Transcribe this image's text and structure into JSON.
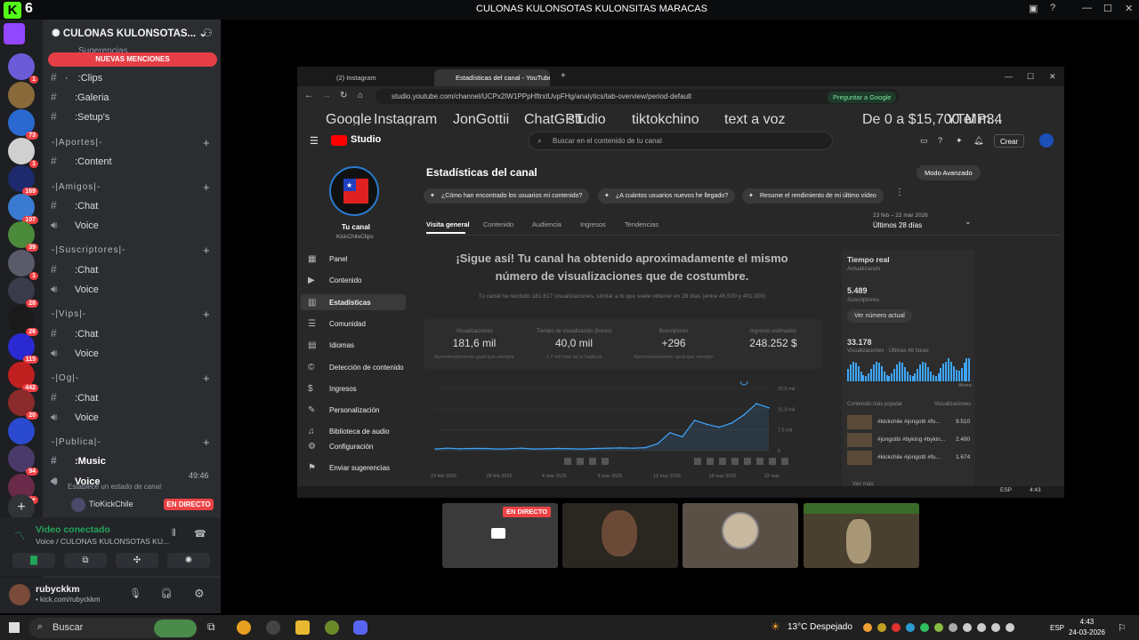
{
  "kick": {
    "logo": "K",
    "count": "6"
  },
  "window": {
    "title": "CULONAS KULONSOTAS KULONSITAS MARACAS"
  },
  "servers": [
    {
      "badge": "1",
      "color": "#6b5bd6"
    },
    {
      "badge": "",
      "color": "#8a6a3a"
    },
    {
      "badge": "73",
      "color": "#2a6ad0"
    },
    {
      "badge": "1",
      "color": "#d0d0d0"
    },
    {
      "badge": "169",
      "color": "#1e2a6e"
    },
    {
      "badge": "107",
      "color": "#3a7ad0"
    },
    {
      "badge": "39",
      "color": "#4a8a3a"
    },
    {
      "badge": "1",
      "color": "#5a5a6a"
    },
    {
      "badge": "28",
      "color": "#3a3a4a"
    },
    {
      "badge": "26",
      "color": "#1a1a1a"
    },
    {
      "badge": "115",
      "color": "#2a2ad0"
    },
    {
      "badge": "442",
      "color": "#c02020"
    },
    {
      "badge": "20",
      "color": "#8a2a2a"
    },
    {
      "badge": "",
      "color": "#2a4ad0"
    },
    {
      "badge": "94",
      "color": "#4a3a6a"
    },
    {
      "badge": "2K+",
      "color": "#6a2a4a"
    }
  ],
  "sidebar": {
    "server_name": "CULONAS KULONSOTAS...",
    "mentions": "NUEVAS MENCIONES",
    "partial_top": "Sugerencias",
    "items": [
      {
        "kind": "ch",
        "label": "· :Clips"
      },
      {
        "kind": "ch",
        "label": " :Galeria"
      },
      {
        "kind": "ch",
        "label": " :Setup's"
      },
      {
        "kind": "cat",
        "label": "-|Aportes|-"
      },
      {
        "kind": "ch",
        "label": " :Content"
      },
      {
        "kind": "cat",
        "label": "-|Amigos|-"
      },
      {
        "kind": "ch",
        "label": " :Chat"
      },
      {
        "kind": "vc",
        "label": " Voice"
      },
      {
        "kind": "cat",
        "label": "-|Suscriptores|-"
      },
      {
        "kind": "ch",
        "label": " :Chat"
      },
      {
        "kind": "vc",
        "label": " Voice"
      },
      {
        "kind": "cat",
        "label": "-|Vips|-"
      },
      {
        "kind": "ch",
        "label": " :Chat"
      },
      {
        "kind": "vc",
        "label": " Voice"
      },
      {
        "kind": "cat",
        "label": "-|Og|-"
      },
      {
        "kind": "ch",
        "label": " :Chat"
      },
      {
        "kind": "vc",
        "label": " Voice"
      },
      {
        "kind": "cat",
        "label": "-|Publica|-"
      },
      {
        "kind": "ch",
        "label": " :Music"
      },
      {
        "kind": "vc",
        "label": " Voice"
      }
    ],
    "voice_timer": "49:46",
    "status_hint": "Establece un estado de canal",
    "member": "TioKickChile",
    "live": "EN DIRECTO"
  },
  "voice": {
    "connected": "Video conectado",
    "channel": "Voice / CULONAS KULONSOTAS KU..."
  },
  "user": {
    "name": "rubyckkm",
    "status": "• kick.com/rubyckkm"
  },
  "browser": {
    "tab1": "(2) Instagram",
    "tab2": "Estadísticas del canal - YouTube",
    "url": "studio.youtube.com/channel/UCPx2IW1PPpHftrxtUvpFHg/analytics/tab-overview/period-default",
    "ask_google": "Preguntar a Google",
    "bookmarks": [
      "Google",
      "Instagram",
      "JonGottii",
      "ChatGPT",
      "studio",
      "tiktokchino",
      "text a voz",
      "De 0 a $15,700 el m...",
      "YTMP34"
    ]
  },
  "studio": {
    "logo": "Studio",
    "search": "Buscar en el contenido de tu canal",
    "create": "Crear",
    "channel_name": "Tu canal",
    "channel_handle": "KickChileClips",
    "nav": [
      "Panel",
      "Contenido",
      "Estadísticas",
      "Comunidad",
      "Idiomas",
      "Detección de contenido",
      "Ingresos",
      "Personalización",
      "Biblioteca de audio",
      "Configuración",
      "Enviar sugerencias"
    ],
    "title": "Estadísticas del canal",
    "advanced": "Modo Avanzado",
    "pills": [
      "¿Cómo han encontrado los usuarios mi contenido?",
      "¿A cuántos usuarios nuevos he llegado?",
      "Resume el rendimiento de mi último vídeo"
    ],
    "tabs": [
      "Visita general",
      "Contenido",
      "Audiencia",
      "Ingresos",
      "Tendencias"
    ],
    "date_range": "23 feb – 22 mar 2026",
    "period": "Últimos 28 días",
    "headline": "¡Sigue así! Tu canal ha obtenido aproximadamente el mismo número de visualizaciones que de costumbre.",
    "subline": "Tu canal ha recibido 181.617 visualizaciones, similar a lo que suele obtener en 28 días (entre 46.500 y 401.000)",
    "metrics": [
      {
        "label": "Visualizaciones",
        "value": "181,6 mil",
        "note": "Aproximadamente igual que siempre"
      },
      {
        "label": "Tiempo de visualización (horas)",
        "value": "40,0 mil",
        "note": "1,7 mil más de lo habitual"
      },
      {
        "label": "Suscriptores",
        "value": "+296",
        "note": "Aproximadamente igual que siempre"
      },
      {
        "label": "Ingresos estimados",
        "value": "248.252 $",
        "note": ""
      }
    ],
    "realtime": {
      "title": "Tiempo real",
      "updating": "Actualizando",
      "subs": "5.489",
      "subs_label": "Suscriptores",
      "see": "Ver número actual",
      "views": "33.178",
      "views_label": "Visualizaciones · Últimas 48 horas",
      "now": "Ahora",
      "popular": "Contenido más popular",
      "popular_col": "Visualizaciones",
      "videos": [
        {
          "t": "#kickchile #jongotti #fu...",
          "v": "9.510"
        },
        {
          "t": "#jongottii #byking #bykin...",
          "v": "2.490"
        },
        {
          "t": "#kickchile #jongotti #fu...",
          "v": "1.674"
        }
      ],
      "more": "Ver más"
    },
    "chart_axis": [
      "22,5 mil",
      "15,0 mil",
      "7,5 mil",
      "0"
    ],
    "chart_dates": [
      "23 feb 2026",
      "28 feb 2026",
      "4 mar 2026",
      "9 mar 2026",
      "13 mar 2026",
      "18 mar 2026",
      "22 mar"
    ]
  },
  "chart_data": {
    "type": "line",
    "x": [
      "23 feb",
      "24 feb",
      "25 feb",
      "26 feb",
      "27 feb",
      "28 feb",
      "1 mar",
      "2 mar",
      "3 mar",
      "4 mar",
      "5 mar",
      "6 mar",
      "7 mar",
      "8 mar",
      "9 mar",
      "10 mar",
      "11 mar",
      "12 mar",
      "13 mar",
      "14 mar",
      "15 mar",
      "16 mar",
      "17 mar",
      "18 mar",
      "19 mar",
      "20 mar",
      "21 mar",
      "22 mar"
    ],
    "series": [
      {
        "values": [
          600,
          900,
          700,
          800,
          800,
          600,
          700,
          900,
          600,
          700,
          800,
          700,
          600,
          800,
          900,
          1000,
          900,
          1100,
          2500,
          6500,
          5000,
          11000,
          9500,
          8500,
          10000,
          13000,
          17000,
          15500
        ]
      }
    ],
    "ylim": [
      0,
      22500
    ],
    "yticks": [
      "22,5 mil",
      "15,0 mil",
      "7,5 mil",
      "0"
    ],
    "xticks": [
      "23 feb 2026",
      "28 feb 2026",
      "4 mar 2026",
      "9 mar 2026",
      "13 mar 2026",
      "18 mar 2026",
      "22 mar"
    ]
  },
  "tiles": {
    "live": "EN DIRECTO"
  },
  "taskbar": {
    "search": "Buscar",
    "weather": "13°C  Despejado",
    "lang": "ESP",
    "time": "4:43",
    "date": "24-03-2026"
  }
}
